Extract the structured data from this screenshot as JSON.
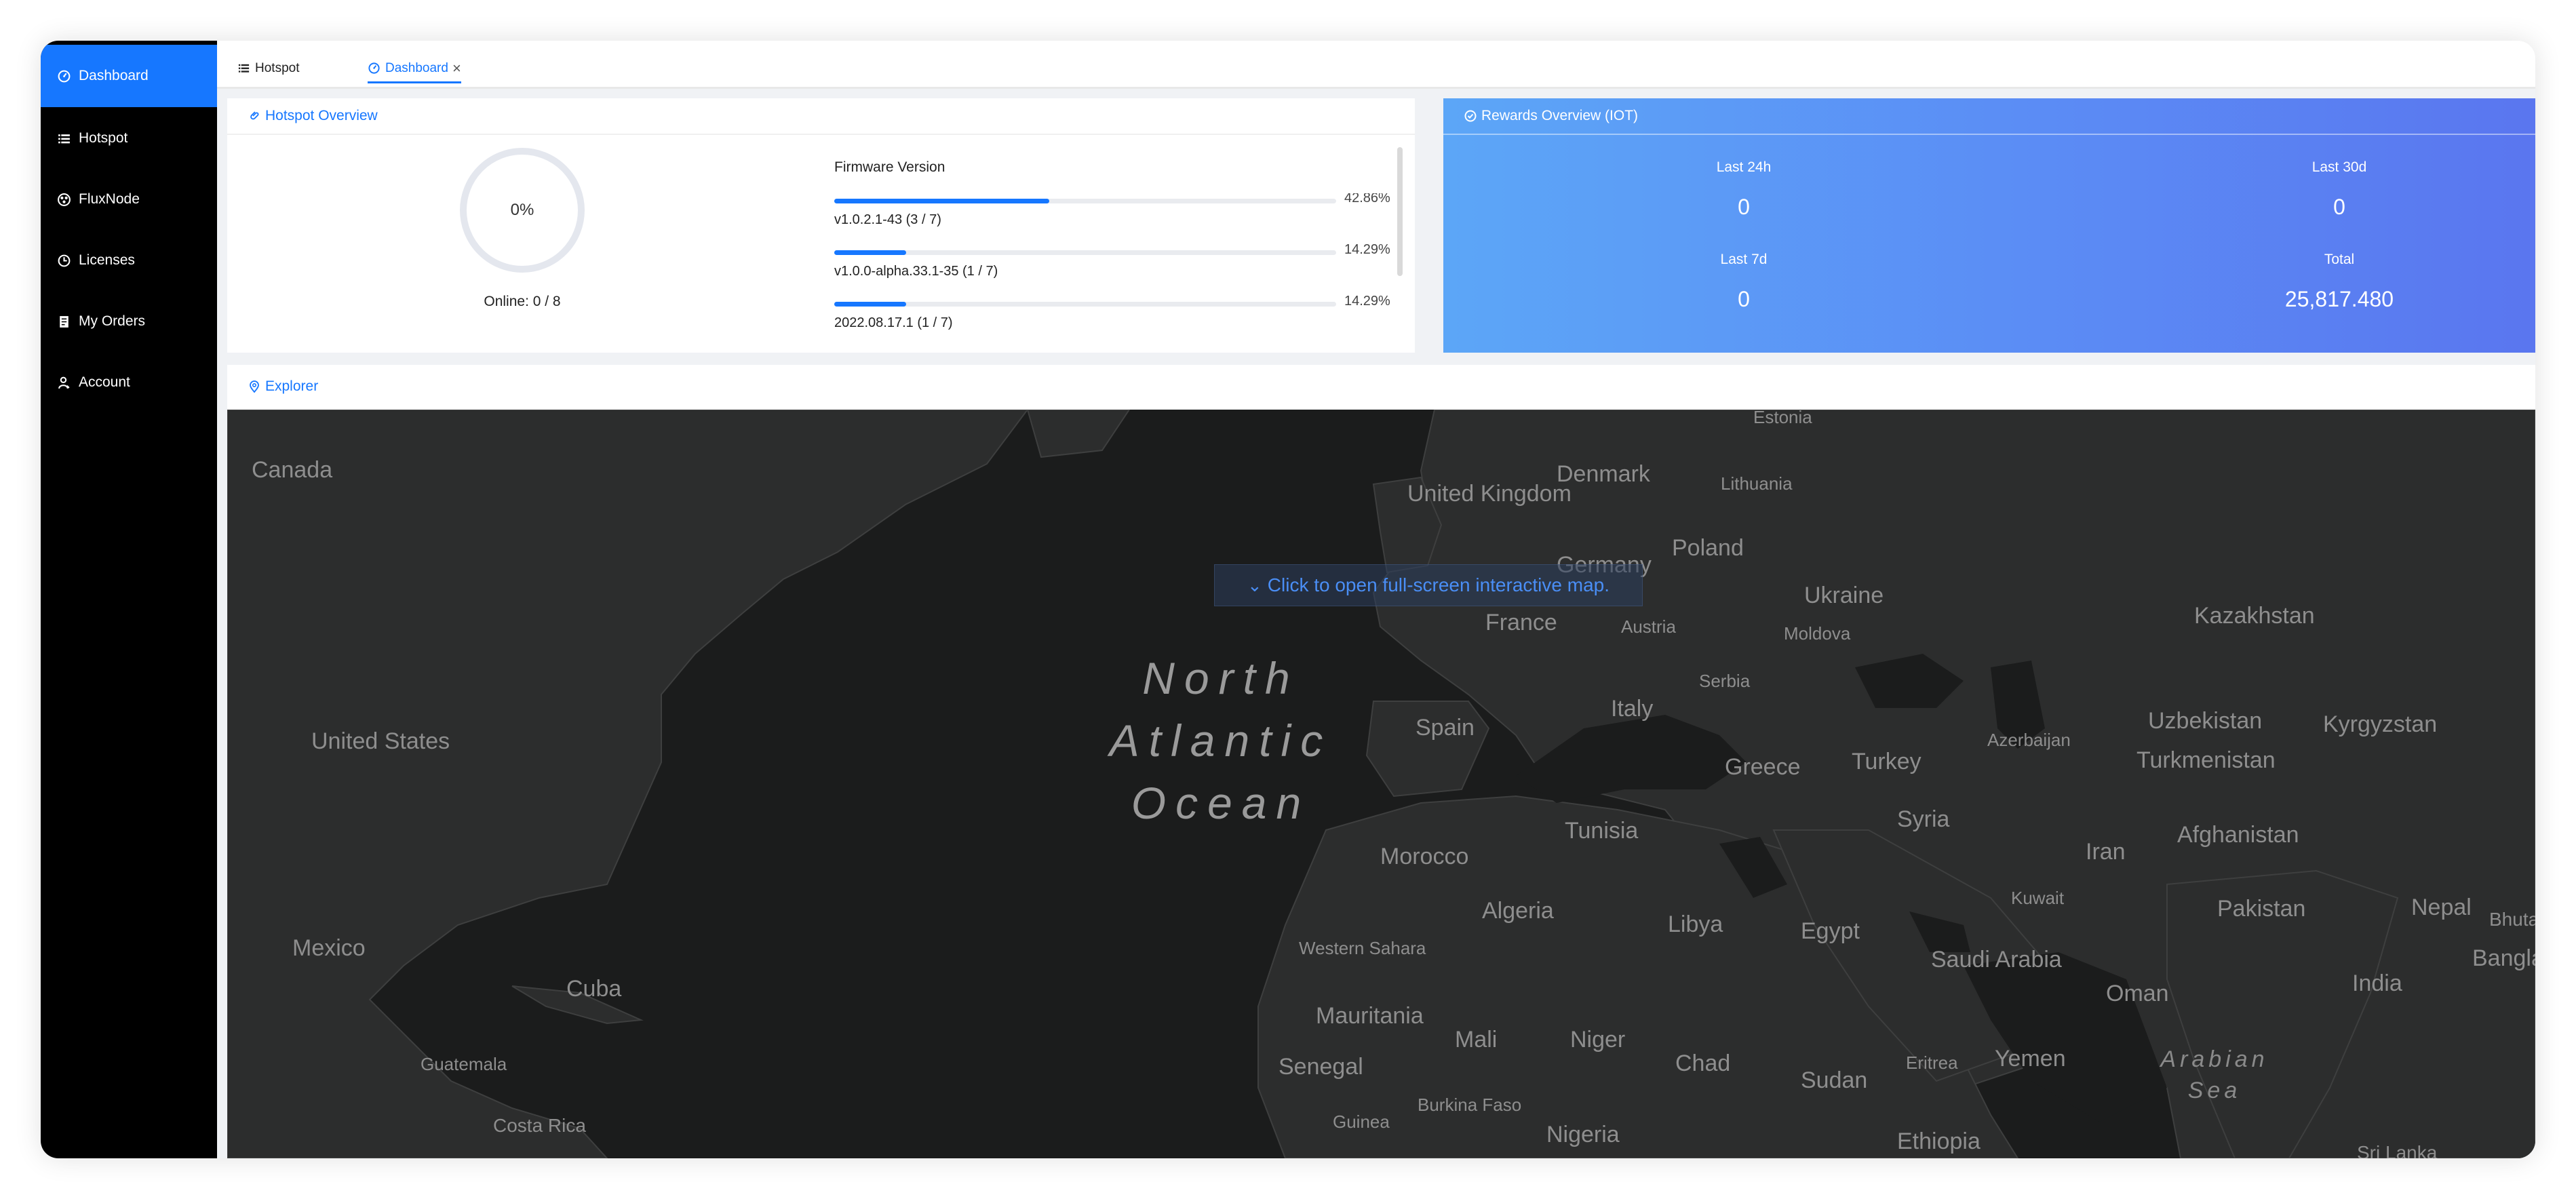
{
  "sidebar": {
    "items": [
      {
        "label": "Dashboard",
        "icon": "dashboard-icon",
        "active": true
      },
      {
        "label": "Hotspot",
        "icon": "list-icon"
      },
      {
        "label": "FluxNode",
        "icon": "flux-icon"
      },
      {
        "label": "Licenses",
        "icon": "clock-icon"
      },
      {
        "label": "My Orders",
        "icon": "orders-icon"
      },
      {
        "label": "Account",
        "icon": "user-icon"
      }
    ]
  },
  "tabs": [
    {
      "label": "Hotspot",
      "icon": "list-icon"
    },
    {
      "label": "Dashboard",
      "icon": "dashboard-icon",
      "active": true,
      "close": "×"
    }
  ],
  "hotspot_overview": {
    "title": "Hotspot Overview",
    "online_percent": "0%",
    "online_text": "Online: 0 / 8",
    "firmware_title": "Firmware Version",
    "firmware": [
      {
        "label": "v1.0.2.1-43 (3 / 7)",
        "percent": "42.86%",
        "fraction": 0.4286
      },
      {
        "label": "v1.0.0-alpha.33.1-35 (1 / 7)",
        "percent": "14.29%",
        "fraction": 0.1429
      },
      {
        "label": "2022.08.17.1 (1 / 7)",
        "percent": "14.29%",
        "fraction": 0.1429
      }
    ]
  },
  "rewards": {
    "title": "Rewards Overview (IOT)",
    "stats": [
      {
        "label": "Last 24h",
        "value": "0"
      },
      {
        "label": "Last 30d",
        "value": "0"
      },
      {
        "label": "Last 7d",
        "value": "0"
      },
      {
        "label": "Total",
        "value": "25,817.480"
      }
    ]
  },
  "explorer": {
    "title": "Explorer",
    "banner": "Click to open full-screen interactive map.",
    "ocean_lines": [
      "North",
      "Atlantic",
      "Ocean"
    ],
    "sea_lines": [
      "Arabian",
      "Sea"
    ],
    "labels": [
      "Canada",
      "United States",
      "Mexico",
      "Cuba",
      "Guatemala",
      "Costa Rica",
      "Estonia",
      "Denmark",
      "Lithuania",
      "United Kingdom",
      "Poland",
      "Germany",
      "Ukraine",
      "Moldova",
      "Kazakhstan",
      "France",
      "Austria",
      "Serbia",
      "Italy",
      "Spain",
      "Greece",
      "Turkey",
      "Azerbaijan",
      "Uzbekistan",
      "Kyrgyzstan",
      "Turkmenistan",
      "Syria",
      "Tunisia",
      "Morocco",
      "Iran",
      "Afghanistan",
      "Algeria",
      "Libya",
      "Egypt",
      "Kuwait",
      "Pakistan",
      "Nepal",
      "Bhuta",
      "Western Sahara",
      "Saudi Arabia",
      "Banglad",
      "Mauritania",
      "Mali",
      "Niger",
      "Chad",
      "Sudan",
      "Eritrea",
      "Yemen",
      "Oman",
      "India",
      "Senegal",
      "Burkina Faso",
      "Guinea",
      "Nigeria",
      "Ethiopia",
      "Sri Lanka"
    ]
  },
  "colors": {
    "accent": "#1677ff",
    "sidebar_bg": "#000000",
    "map_bg": "#1b1c1c",
    "land": "#2c2d2d",
    "rewards_gradient_start": "#5ca6f7",
    "rewards_gradient_end": "#5a76ef"
  }
}
